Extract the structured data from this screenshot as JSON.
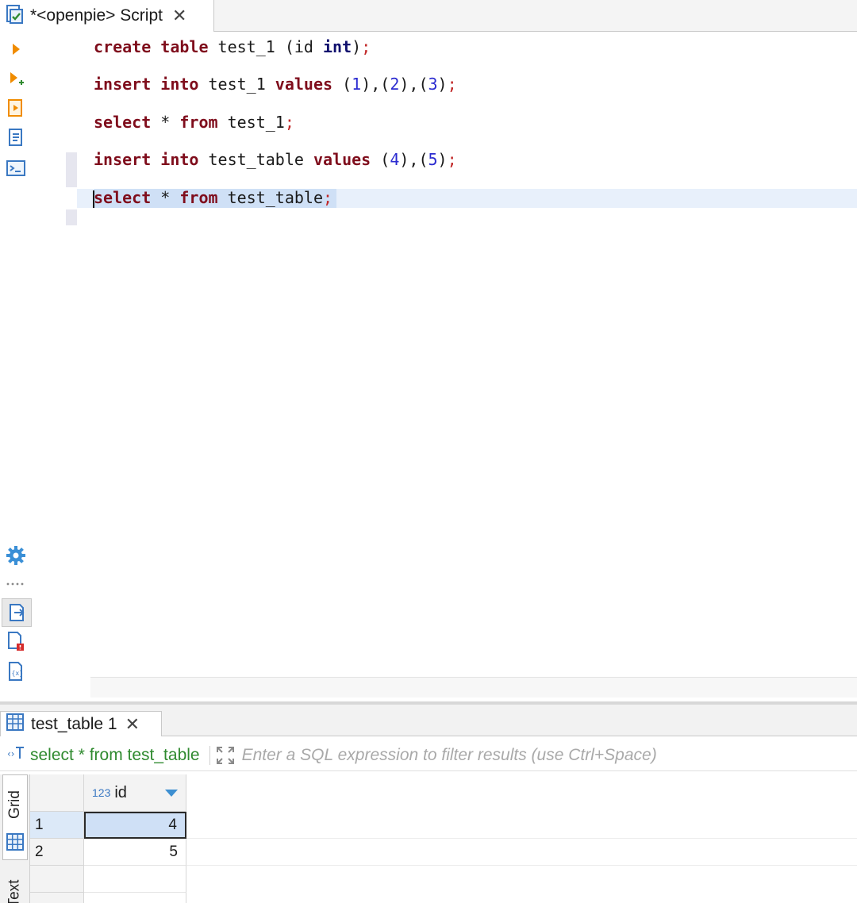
{
  "editor": {
    "tab_title": "*<openpie> Script",
    "lines": [
      {
        "tokens": [
          [
            "kw",
            "create"
          ],
          [
            "t",
            " "
          ],
          [
            "kw",
            "table"
          ],
          [
            "t",
            " test_1 (id "
          ],
          [
            "kw2",
            "int"
          ],
          [
            "t",
            ")"
          ],
          [
            "semi",
            ";"
          ]
        ]
      },
      {
        "tokens": [
          [
            "kw",
            "insert"
          ],
          [
            "t",
            " "
          ],
          [
            "kw",
            "into"
          ],
          [
            "t",
            " test_1 "
          ],
          [
            "kw",
            "values"
          ],
          [
            "t",
            " ("
          ],
          [
            "num",
            "1"
          ],
          [
            "t",
            "),("
          ],
          [
            "num",
            "2"
          ],
          [
            "t",
            "),("
          ],
          [
            "num",
            "3"
          ],
          [
            "t",
            ")"
          ],
          [
            "semi",
            ";"
          ]
        ]
      },
      {
        "tokens": [
          [
            "kw",
            "select"
          ],
          [
            "t",
            " * "
          ],
          [
            "kw",
            "from"
          ],
          [
            "t",
            " test_1"
          ],
          [
            "semi",
            ";"
          ]
        ]
      },
      {
        "tokens": [
          [
            "kw",
            "insert"
          ],
          [
            "t",
            " "
          ],
          [
            "kw",
            "into"
          ],
          [
            "t",
            " test_table "
          ],
          [
            "kw",
            "values"
          ],
          [
            "t",
            " ("
          ],
          [
            "num",
            "4"
          ],
          [
            "t",
            "),("
          ],
          [
            "num",
            "5"
          ],
          [
            "t",
            ")"
          ],
          [
            "semi",
            ";"
          ]
        ]
      },
      {
        "tokens": [
          [
            "kw",
            "select"
          ],
          [
            "t",
            " * "
          ],
          [
            "kw",
            "from"
          ],
          [
            "t",
            " test_table"
          ],
          [
            "semi",
            ";"
          ]
        ]
      }
    ]
  },
  "toolbar": {
    "icons": [
      "execute-statement-icon",
      "execute-script-icon",
      "explain-plan-icon",
      "load-plan-icon",
      "console-icon"
    ],
    "bottom_icons": [
      "settings-icon",
      "more-icon",
      "output-icon",
      "problems-icon",
      "variables-icon"
    ]
  },
  "results": {
    "tab_title": "test_table 1",
    "query": "select * from test_table",
    "filter_placeholder": "Enter a SQL expression to filter results (use Ctrl+Space)",
    "side_tabs": [
      "Grid",
      "Text"
    ],
    "column": {
      "type": "123",
      "name": "id"
    },
    "rows": [
      {
        "num": "1",
        "id": "4"
      },
      {
        "num": "2",
        "id": "5"
      }
    ]
  },
  "colors": {
    "keyword": "#7f0d1c",
    "type_keyword": "#10106e",
    "number": "#2b2bd0",
    "query_green": "#2f8a2f",
    "selection": "#cfe0f6"
  }
}
